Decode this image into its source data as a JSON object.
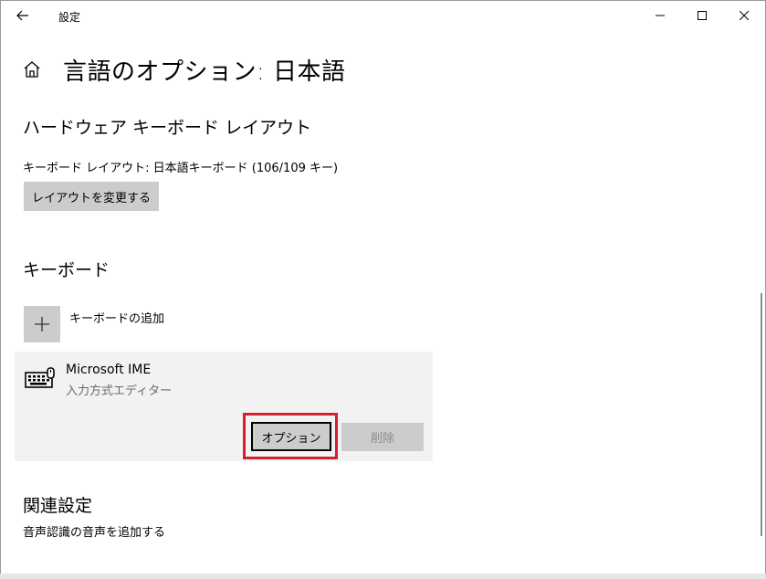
{
  "window": {
    "title": "設定"
  },
  "header": {
    "title": "言語のオプション: 日本語"
  },
  "hardware_layout": {
    "heading": "ハードウェア キーボード レイアウト",
    "current": "キーボード レイアウト: 日本語キーボード (106/109 キー)",
    "change_button": "レイアウトを変更する"
  },
  "keyboard": {
    "heading": "キーボード",
    "add_label": "キーボードの追加",
    "items": [
      {
        "name": "Microsoft IME",
        "subtitle": "入力方式エディター",
        "options_button": "オプション",
        "remove_button": "削除"
      }
    ]
  },
  "related": {
    "heading": "関連設定",
    "link": "音声認識の音声を追加する"
  },
  "icons": {
    "back": "back-arrow-icon",
    "minimize": "minimize-icon",
    "maximize": "maximize-icon",
    "close": "close-icon",
    "home": "home-icon",
    "add": "plus-icon",
    "keyboard": "keyboard-icon"
  },
  "colors": {
    "highlight": "#d3202e",
    "button_bg": "#cccccc",
    "panel_bg": "#f2f2f2"
  }
}
